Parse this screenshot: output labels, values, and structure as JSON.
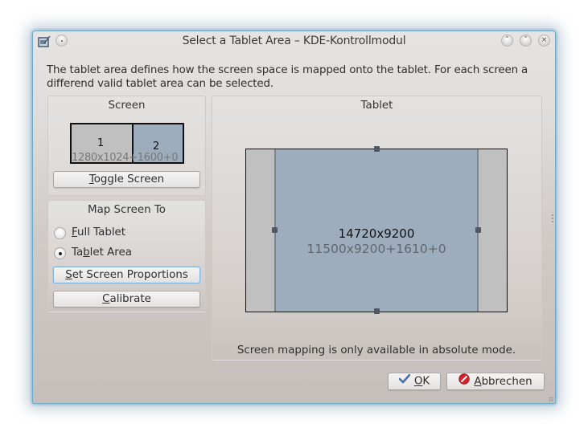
{
  "window": {
    "title": "Select a Tablet Area – KDE-Kontrollmodul",
    "icons": {
      "app": "tablet-icon",
      "menu": "window-menu-icon",
      "keep_above": "keep-above-icon",
      "minimize": "minimize-icon",
      "close": "close-icon"
    },
    "glyphs": {
      "keep_above": "˄",
      "minimize": "˅",
      "close": "×"
    }
  },
  "description": "The tablet area defines how the screen space is mapped onto the tablet. For each screen a differend valid tablet area can be selected.",
  "screen_group": {
    "title": "Screen",
    "screens": [
      {
        "number": "1",
        "resolution": "1280x1024"
      },
      {
        "number": "2",
        "geometry": "+1600+0",
        "selected": true
      }
    ],
    "toggle_button": {
      "mnemonic": "T",
      "rest": "oggle Screen"
    }
  },
  "map_group": {
    "title": "Map Screen To",
    "options": [
      {
        "mnemonic": "F",
        "rest": "ull Tablet",
        "checked": false
      },
      {
        "pre": "Ta",
        "mnemonic": "b",
        "rest": "let Area",
        "checked": true
      }
    ],
    "proportions_button": {
      "mnemonic": "S",
      "rest": "et Screen Proportions"
    },
    "calibrate_button": {
      "mnemonic": "C",
      "rest": "alibrate"
    }
  },
  "tablet_group": {
    "title": "Tablet",
    "tablet_size": "14720x9200",
    "area_geometry": "11500x9200+1610+0",
    "note": "Screen mapping is only available in absolute mode."
  },
  "buttons": {
    "ok": {
      "mnemonic": "O",
      "rest": "K",
      "icon": "checkmark-icon"
    },
    "cancel": {
      "mnemonic": "A",
      "rest": "bbrechen",
      "icon": "cancel-icon"
    }
  },
  "colors": {
    "screen_selected": "#9eadbe",
    "screen_unselected": "#c0c0c0",
    "window_border": "#6fa9c9"
  }
}
